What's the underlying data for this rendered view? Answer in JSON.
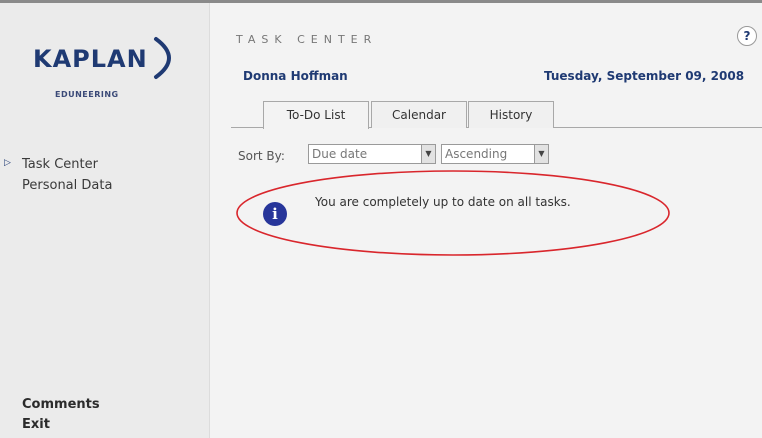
{
  "sidebar": {
    "logo": {
      "text": "KAPLAN",
      "subtext": "EDUNEERING",
      "color": "#1f3a73"
    },
    "nav": [
      {
        "label": "Task Center",
        "selected": true
      },
      {
        "label": "Personal Data",
        "selected": false
      }
    ],
    "footer": [
      {
        "label": "Comments"
      },
      {
        "label": "Exit"
      }
    ]
  },
  "main": {
    "section_title": "TASK CENTER",
    "help_label": "?",
    "user_name": "Donna Hoffman",
    "date": "Tuesday, September 09, 2008",
    "tabs": [
      {
        "label": "To-Do List",
        "active": true
      },
      {
        "label": "Calendar",
        "active": false
      },
      {
        "label": "History",
        "active": false
      }
    ],
    "sort": {
      "label": "Sort By:",
      "field_value": "Due date",
      "order_value": "Ascending"
    },
    "info": {
      "icon": "info-icon",
      "message": "You are completely up to date on all tasks.",
      "highlight_color": "#d9262c"
    }
  }
}
